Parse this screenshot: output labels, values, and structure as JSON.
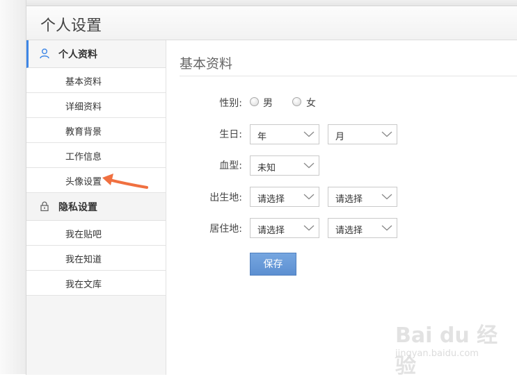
{
  "header": {
    "title": "个人设置"
  },
  "sidebar": {
    "sections": [
      {
        "label": "个人资料",
        "icon": "user-icon",
        "items": [
          "基本资料",
          "详细资料",
          "教育背景",
          "工作信息",
          "头像设置"
        ]
      },
      {
        "label": "隐私设置",
        "icon": "lock-icon",
        "items": [
          "我在贴吧",
          "我在知道",
          "我在文库"
        ]
      }
    ]
  },
  "content": {
    "heading": "基本资料",
    "gender": {
      "label": "性别:",
      "options": [
        "男",
        "女"
      ]
    },
    "birthday": {
      "label": "生日:",
      "year": "年",
      "month": "月"
    },
    "blood": {
      "label": "血型:",
      "value": "未知"
    },
    "birthplace": {
      "label": "出生地:",
      "province": "请选择",
      "city": "请选择"
    },
    "residence": {
      "label": "居住地:",
      "province": "请选择",
      "city": "请选择"
    },
    "save_label": "保存"
  },
  "watermark": {
    "brand": "Bai du 经验",
    "url": "jingyan.baidu.com"
  },
  "colors": {
    "accent": "#3d86e6",
    "button": "#5c8fd1",
    "arrow": "#f07040"
  }
}
